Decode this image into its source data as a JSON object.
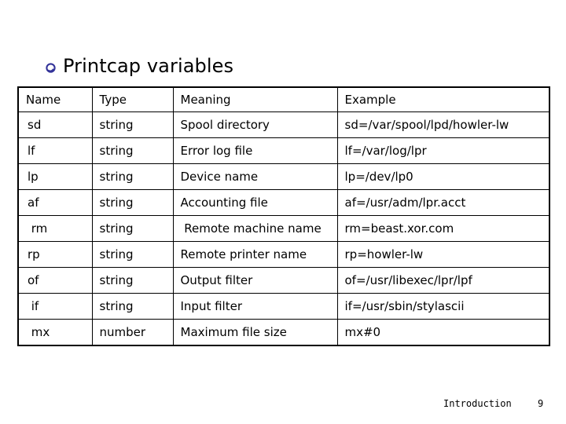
{
  "slide": {
    "title": "Printcap variables",
    "bullet_icon": "ring-bullet-icon",
    "bullet_color": "#333399",
    "background_color": "#ffffff",
    "text_color": "#000000"
  },
  "table": {
    "columns": [
      "Name",
      "Type",
      "Meaning",
      "Example"
    ],
    "rows": [
      {
        "name": "sd",
        "type": "string",
        "meaning": "Spool directory",
        "example": "sd=/var/spool/lpd/howler-lw"
      },
      {
        "name": "lf",
        "type": "string",
        "meaning": "Error log file",
        "example": "lf=/var/log/lpr"
      },
      {
        "name": "lp",
        "type": "string",
        "meaning": "Device name",
        "example": "lp=/dev/lp0"
      },
      {
        "name": "af",
        "type": "string",
        "meaning": "Accounting file",
        "example": "af=/usr/adm/lpr.acct"
      },
      {
        "name": " rm",
        "type": "string",
        "meaning": " Remote machine name",
        "example": "rm=beast.xor.com"
      },
      {
        "name": "rp",
        "type": "string",
        "meaning": "Remote printer name",
        "example": "rp=howler-lw"
      },
      {
        "name": "of",
        "type": "string",
        "meaning": "Output filter",
        "example": "of=/usr/libexec/lpr/lpf"
      },
      {
        "name": " if",
        "type": "string",
        "meaning": "Input filter",
        "example": "if=/usr/sbin/stylascii"
      },
      {
        "name": " mx",
        "type": "number",
        "meaning": "Maximum file size",
        "example": "mx#0"
      }
    ]
  },
  "footer": {
    "section_label": "Introduction",
    "page_number": "9"
  }
}
